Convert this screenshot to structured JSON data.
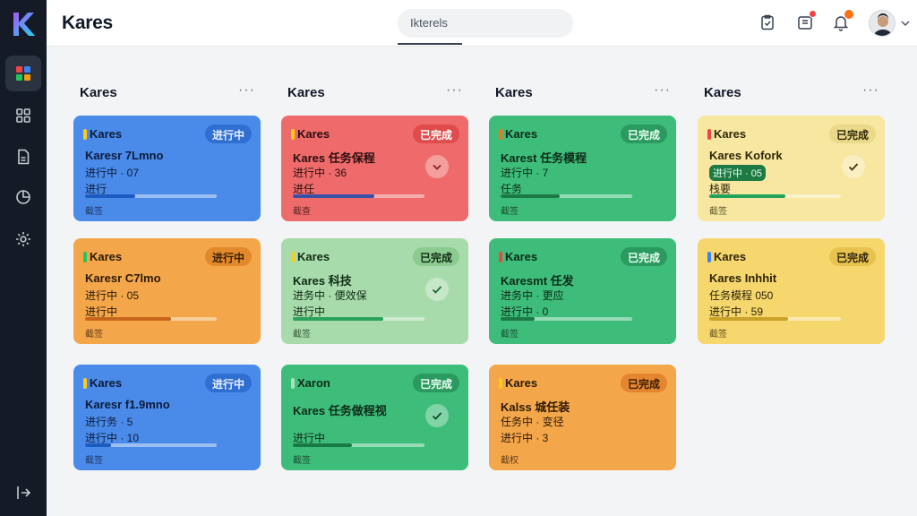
{
  "app": {
    "title": "Kares"
  },
  "search": {
    "value": "Ikterels"
  },
  "columns": [
    {
      "title": "Kares",
      "more": "···"
    },
    {
      "title": "Kares",
      "more": "···"
    },
    {
      "title": "Kares",
      "more": "···"
    },
    {
      "title": "Kares",
      "more": "···"
    }
  ],
  "cards": [
    {
      "title": "Kares",
      "badge": "进行中",
      "main": "Karesr 7Lmno",
      "line2": "进行中 · 07",
      "line3": "进行",
      "progress": 0.38,
      "foot": "截签",
      "color": "#4a8bea"
    },
    {
      "title": "Kares",
      "badge": "已完成",
      "main": "Kares 任务保程",
      "line2": "进行中 · 36",
      "line3": "进任",
      "progress": 0.62,
      "foot": "截查",
      "color": "#ef6b6b"
    },
    {
      "title": "Kares",
      "badge": "已完成",
      "main": "Karest 任务模程",
      "line2": "进行中 · 7",
      "line3": "任务",
      "progress": 0.45,
      "foot": "截签",
      "color": "#3ebd7a"
    },
    {
      "title": "Kares",
      "badge": "已完成",
      "main": "Kares Kofork",
      "line2": "进行中 · 05",
      "line3": "栈要",
      "progress": 0.58,
      "foot": "截签",
      "color": "#f7e7a1"
    },
    {
      "title": "Kares",
      "badge": "进行中",
      "main": "Karesr C7lmo",
      "line2": "进行中 · 05",
      "line3": "进行中",
      "progress": 0.65,
      "foot": "截签",
      "color": "#f4a64a"
    },
    {
      "title": "Kares",
      "badge": "已完成",
      "main": "Kares 科技",
      "line2": "进务中 · 便效保",
      "line3": "进行中",
      "progress": 0.69,
      "foot": "截签",
      "color": "#a8dbab"
    },
    {
      "title": "Kares",
      "badge": "已完成",
      "main": "Karesmt 任发",
      "line2": "进务中 · 更应",
      "line3": "进行中 · 0",
      "progress": 0.26,
      "foot": "截签",
      "color": "#3ebd7a"
    },
    {
      "title": "Kares",
      "badge": "已完成",
      "main": "Kares Inhhit",
      "line2": "任务模程 050",
      "line3": "进行中 · 59",
      "progress": 0.6,
      "foot": "截签",
      "color": "#f6d76d"
    },
    {
      "title": "Kares",
      "badge": "进行中",
      "main": "Karesr f1.9mno",
      "line2": "进行务 · 5",
      "line3": "进行中 · 10",
      "progress": 0.2,
      "foot": "截签",
      "color": "#4a8bea"
    },
    {
      "title": "Xaron",
      "badge": "已完成",
      "main": "Kares 任务做程视",
      "line2": "",
      "line3": "进行中",
      "progress": 0.45,
      "foot": "截签",
      "color": "#3ebd7a"
    },
    {
      "title": "Kares",
      "badge": "已完成",
      "main": "Kalss 城任装",
      "line2": "任务中 · 变径",
      "line3": "进行中 · 3",
      "progress": 0.0,
      "foot": "截权",
      "color": "#f4a64a"
    }
  ]
}
